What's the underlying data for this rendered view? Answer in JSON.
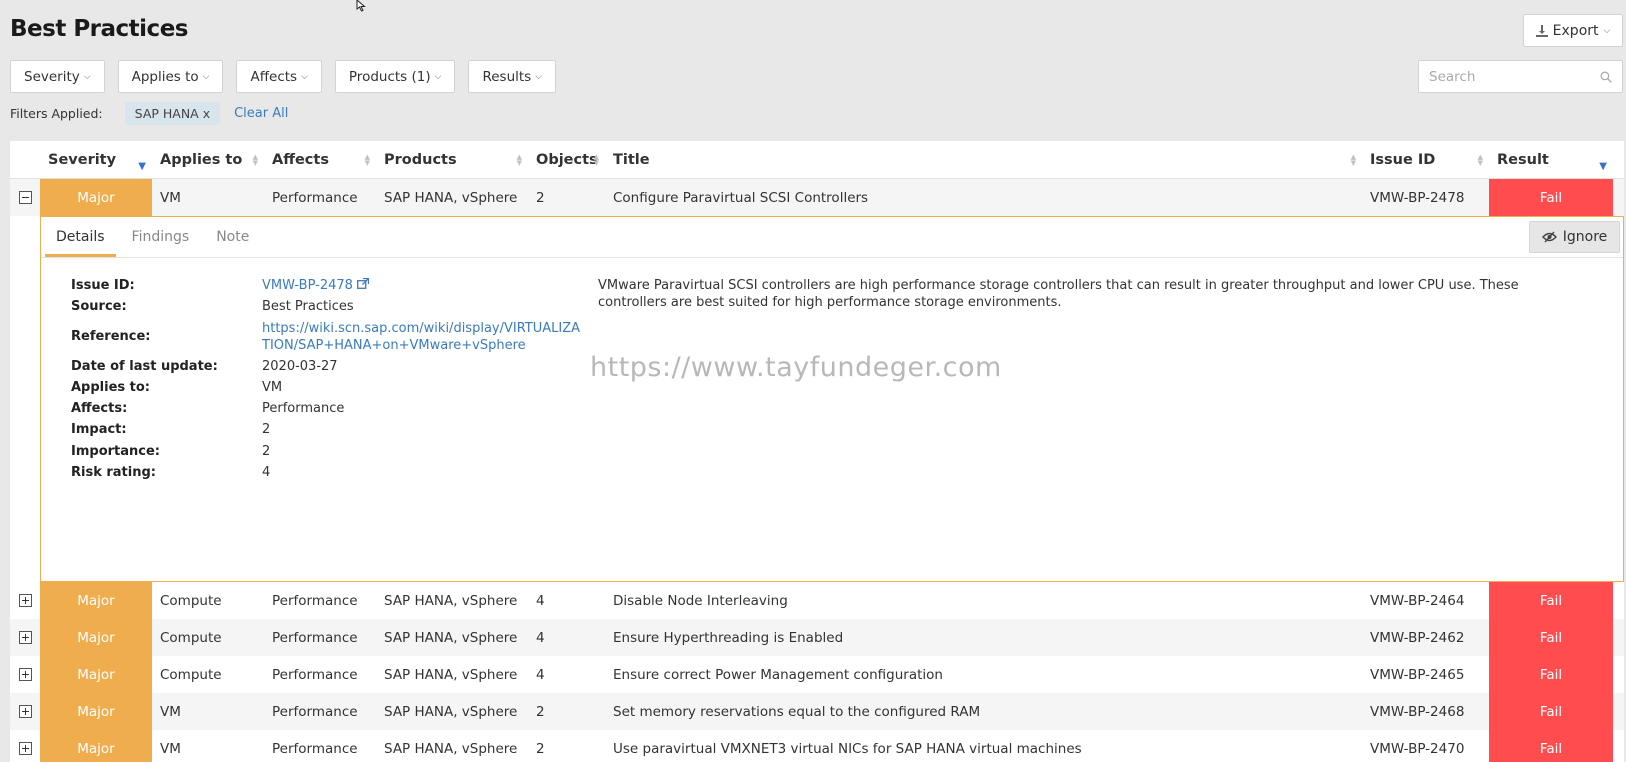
{
  "page": {
    "title": "Best Practices"
  },
  "toolbar": {
    "export_label": "Export"
  },
  "filters": [
    {
      "label": "Severity"
    },
    {
      "label": "Applies to"
    },
    {
      "label": "Affects"
    },
    {
      "label": "Products (1)"
    },
    {
      "label": "Results"
    }
  ],
  "search": {
    "placeholder": "Search"
  },
  "filters_applied": {
    "label": "Filters Applied:",
    "chips": [
      "SAP HANA x"
    ],
    "clear_all": "Clear All"
  },
  "table": {
    "columns": [
      "Severity",
      "Applies to",
      "Affects",
      "Products",
      "Objects",
      "Title",
      "Issue ID",
      "Result"
    ],
    "rows": [
      {
        "severity": "Major",
        "applies_to": "VM",
        "affects": "Performance",
        "products": "SAP HANA, vSphere",
        "objects": "2",
        "title": "Configure Paravirtual SCSI Controllers",
        "issue_id": "VMW-BP-2478",
        "result": "Fail",
        "expanded": true
      },
      {
        "severity": "Major",
        "applies_to": "Compute",
        "affects": "Performance",
        "products": "SAP HANA, vSphere",
        "objects": "4",
        "title": "Disable Node Interleaving",
        "issue_id": "VMW-BP-2464",
        "result": "Fail"
      },
      {
        "severity": "Major",
        "applies_to": "Compute",
        "affects": "Performance",
        "products": "SAP HANA, vSphere",
        "objects": "4",
        "title": "Ensure Hyperthreading is Enabled",
        "issue_id": "VMW-BP-2462",
        "result": "Fail"
      },
      {
        "severity": "Major",
        "applies_to": "Compute",
        "affects": "Performance",
        "products": "SAP HANA, vSphere",
        "objects": "4",
        "title": "Ensure correct Power Management configuration",
        "issue_id": "VMW-BP-2465",
        "result": "Fail"
      },
      {
        "severity": "Major",
        "applies_to": "VM",
        "affects": "Performance",
        "products": "SAP HANA, vSphere",
        "objects": "2",
        "title": "Set memory reservations equal to the configured RAM",
        "issue_id": "VMW-BP-2468",
        "result": "Fail"
      },
      {
        "severity": "Major",
        "applies_to": "VM",
        "affects": "Performance",
        "products": "SAP HANA, vSphere",
        "objects": "2",
        "title": "Use paravirtual VMXNET3 virtual NICs for SAP HANA virtual machines",
        "issue_id": "VMW-BP-2470",
        "result": "Fail"
      }
    ]
  },
  "detail": {
    "tabs": [
      "Details",
      "Findings",
      "Note"
    ],
    "ignore_label": "Ignore",
    "fields": {
      "issue_id": {
        "k": "Issue ID:",
        "v": "VMW-BP-2478"
      },
      "source": {
        "k": "Source:",
        "v": "Best Practices"
      },
      "reference": {
        "k": "Reference:",
        "v1": "https://wiki.scn.sap.com/wiki/display/VIRTUALIZA",
        "v2": "TION/SAP+HANA+on+VMware+vSphere"
      },
      "date": {
        "k": "Date of last update:",
        "v": "2020-03-27"
      },
      "applies_to": {
        "k": "Applies to:",
        "v": "VM"
      },
      "affects": {
        "k": "Affects:",
        "v": "Performance"
      },
      "impact": {
        "k": "Impact:",
        "v": "2"
      },
      "importance": {
        "k": "Importance:",
        "v": "2"
      },
      "risk": {
        "k": "Risk rating:",
        "v": "4"
      }
    },
    "description": "VMware Paravirtual SCSI controllers are high performance storage controllers that can result in greater throughput and lower CPU use. These controllers are best suited for high performance storage environments."
  },
  "watermark": "https://www.tayfundeger.com",
  "colors": {
    "severity_major": "#f0ad4e",
    "result_fail": "#ff4d4f",
    "link": "#3a7bbf"
  }
}
